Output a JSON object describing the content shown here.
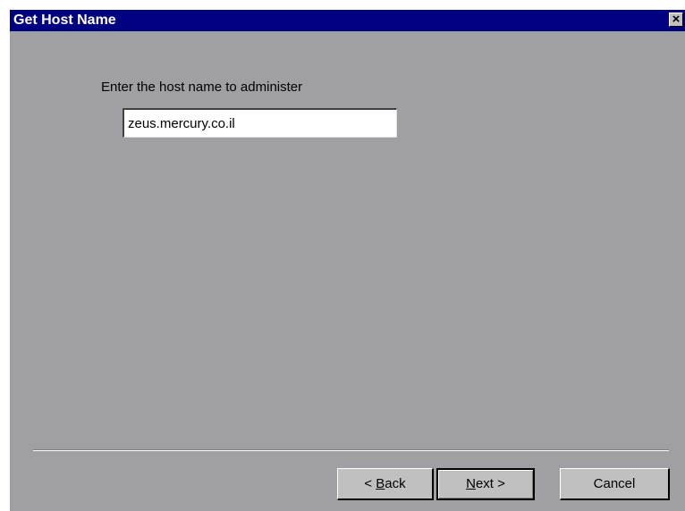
{
  "window": {
    "title": "Get Host Name",
    "close_glyph": "×"
  },
  "form": {
    "prompt_label": "Enter the host name to administer",
    "host_value": "zeus.mercury.co.il"
  },
  "buttons": {
    "back": {
      "prefix": "< ",
      "accel": "B",
      "rest": "ack"
    },
    "next": {
      "accel": "N",
      "rest": "ext >"
    },
    "cancel": "Cancel"
  },
  "colors": {
    "titlebar": "#000080",
    "dialog_bg": "#a0a0a4",
    "button_face": "#c0c0c0"
  }
}
